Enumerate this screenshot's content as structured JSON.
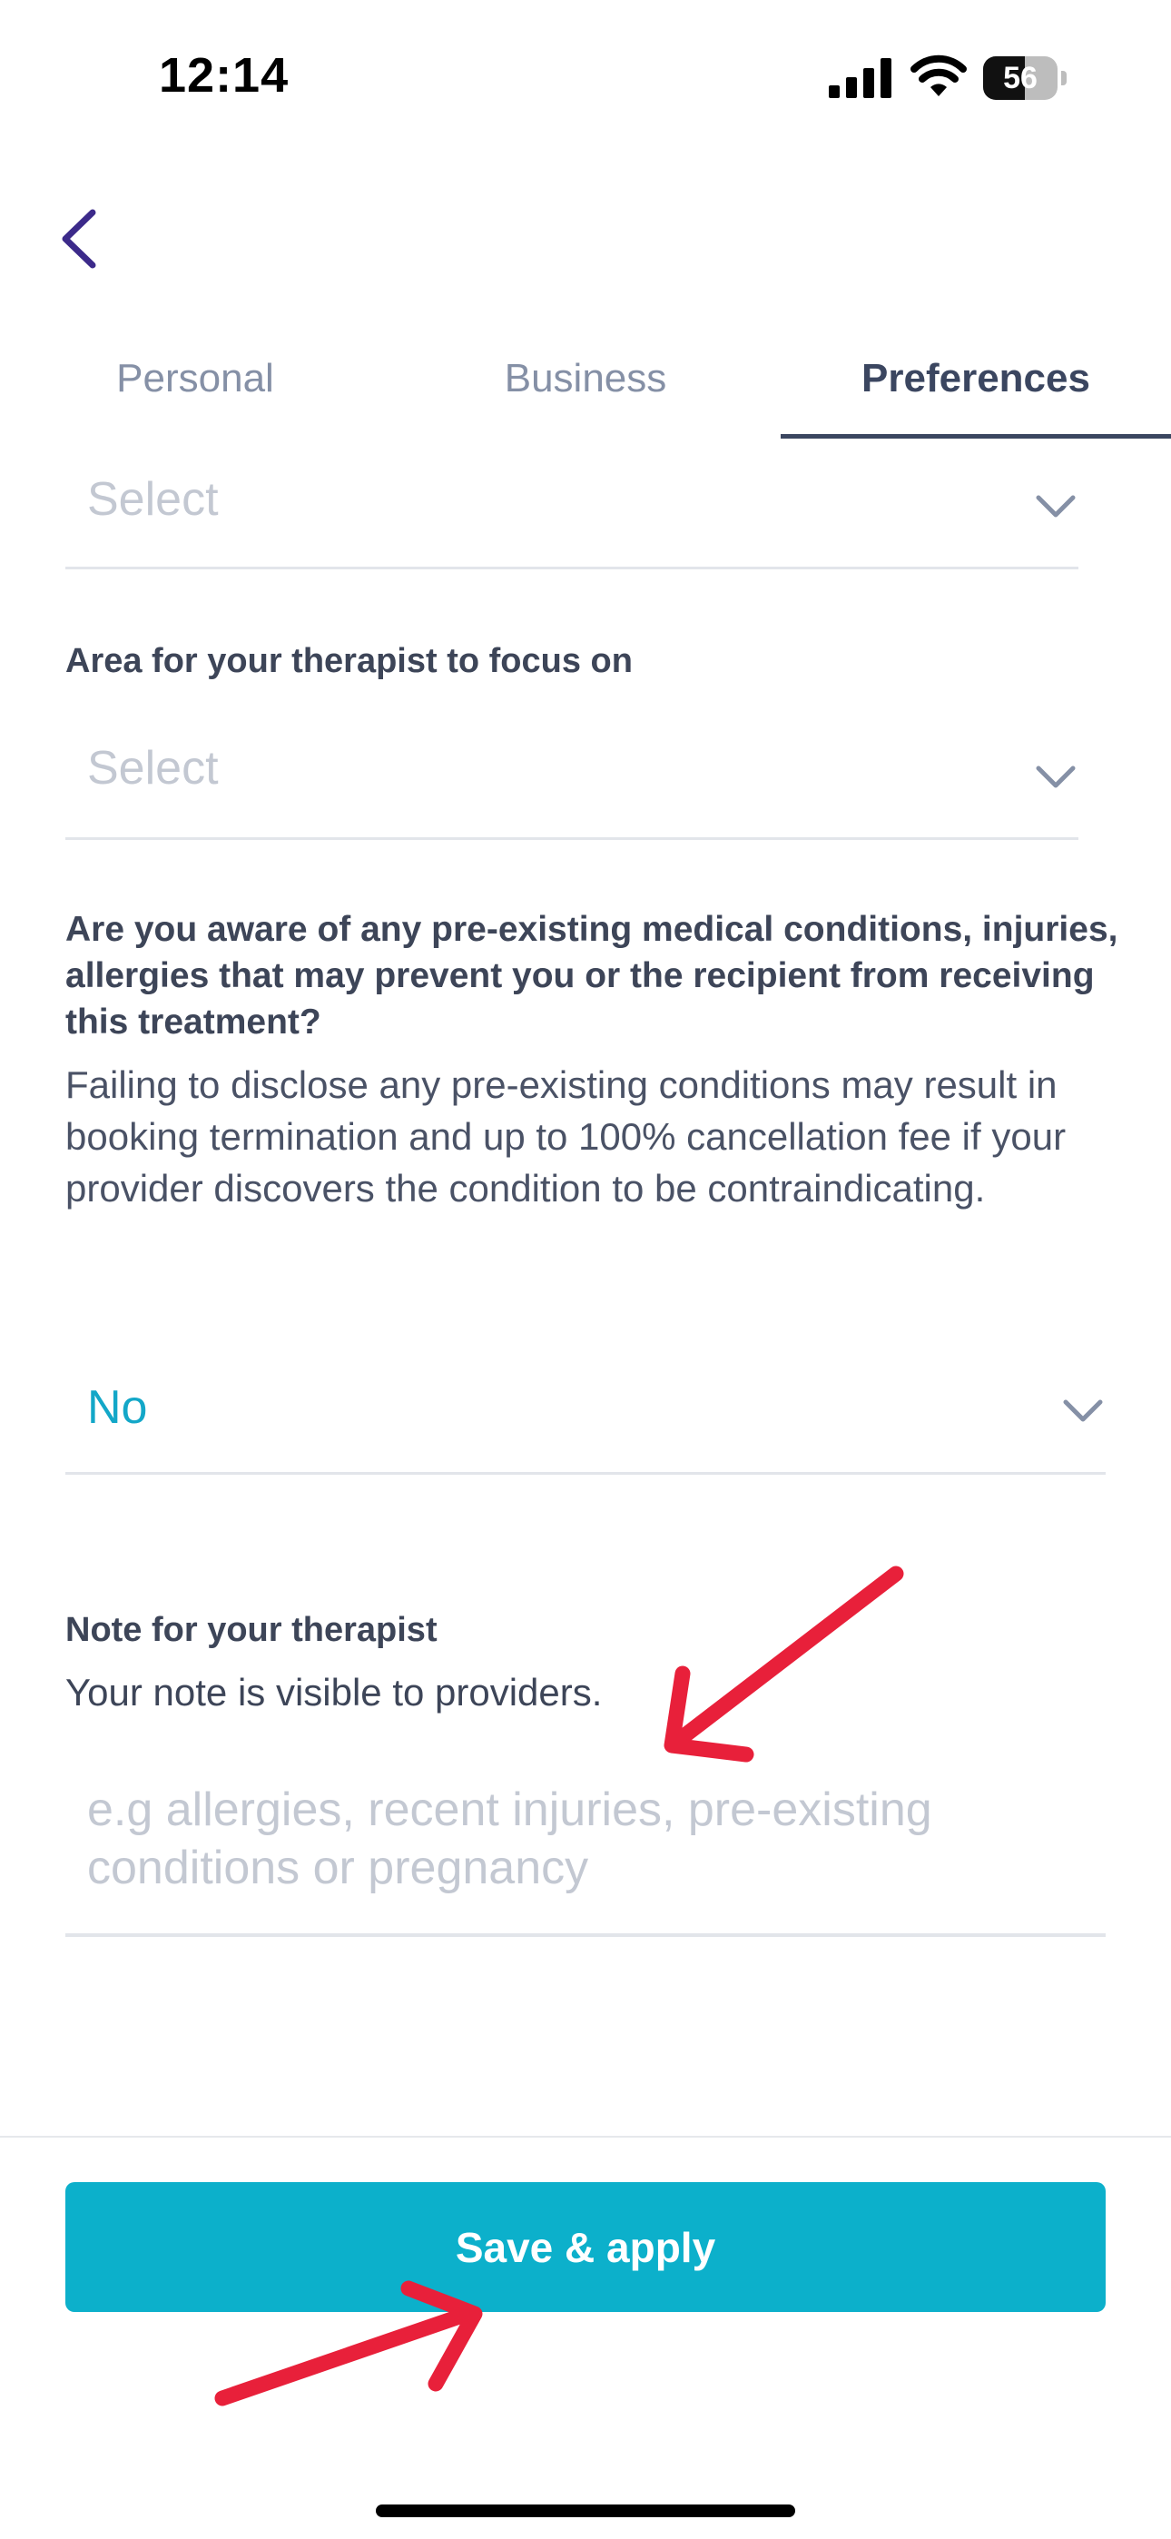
{
  "status_bar": {
    "time": "12:14",
    "battery_level": "56",
    "battery_fraction": 0.56
  },
  "tabs": [
    {
      "label": "Personal",
      "active": false
    },
    {
      "label": "Business",
      "active": false
    },
    {
      "label": "Preferences",
      "active": true
    }
  ],
  "form": {
    "first_select": {
      "placeholder": "Select"
    },
    "focus_area": {
      "label": "Area for your therapist to focus on",
      "placeholder": "Select"
    },
    "medical_conditions": {
      "question": "Are you aware of any pre-existing medical conditions, injuries, allergies that may prevent you or the recipient from receiving this treatment?",
      "helper": "Failing to disclose any pre-existing conditions may result in booking termination and up to 100% cancellation fee if your provider discovers the condition to be contraindicating.",
      "value": "No"
    },
    "note": {
      "label": "Note for your therapist",
      "helper": "Your note is visible to providers.",
      "placeholder": "e.g allergies, recent injuries, pre-existing conditions or pregnancy"
    }
  },
  "footer": {
    "save_label": "Save & apply"
  },
  "colors": {
    "accent": "#0cb0cb",
    "annotation": "#e8203a",
    "text": "#3d4558",
    "back_icon": "#3c2a8a"
  },
  "icons": [
    "back-chevron-icon",
    "chevron-down-icon",
    "signal-icon",
    "wifi-icon",
    "battery-icon"
  ]
}
